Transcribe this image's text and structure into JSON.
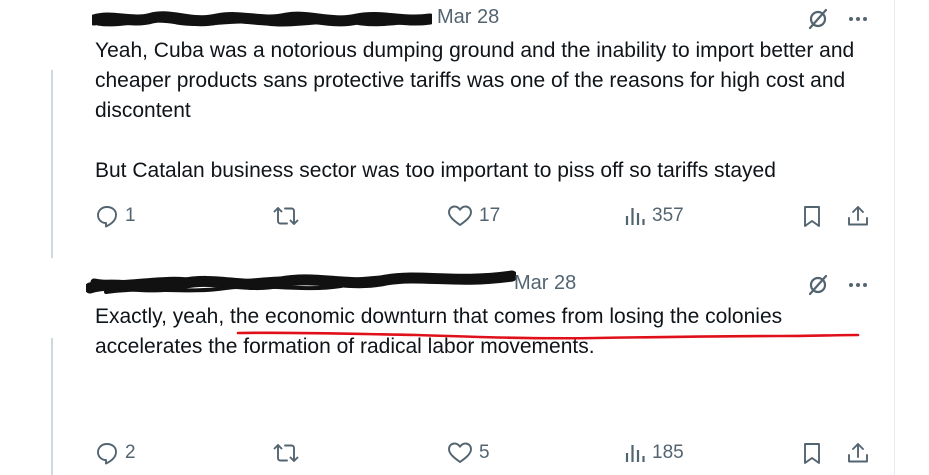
{
  "tweets": [
    {
      "date": "Mar 28",
      "text": "Yeah, Cuba was a notorious dumping ground and the inability to import better and cheaper products sans protective tariffs was one of the reasons for high cost and discontent\n\nBut Catalan business sector was too important to piss off so tariffs stayed",
      "replies": "1",
      "retweets": "",
      "likes": "17",
      "views": "357"
    },
    {
      "date": "Mar 28",
      "text_before": "Exactly, yeah, ",
      "text_highlight": "the economic downturn that comes from losing the colonies",
      "text_after": " accelerates the formation of radical labor movements.",
      "replies": "2",
      "retweets": "",
      "likes": "5",
      "views": "185"
    }
  ],
  "colors": {
    "muted": "#536471",
    "text": "#0f1419",
    "highlight": "#e0101a",
    "redaction": "#111111"
  },
  "icons": [
    "grok-icon",
    "more-icon",
    "reply-icon",
    "retweet-icon",
    "like-icon",
    "views-icon",
    "bookmark-icon",
    "share-icon"
  ]
}
